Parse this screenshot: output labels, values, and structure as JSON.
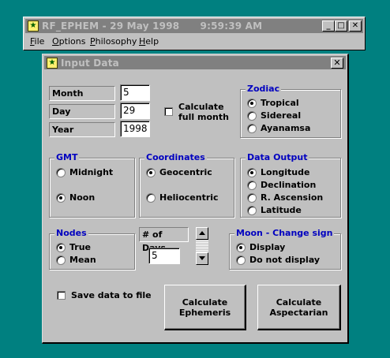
{
  "main_window": {
    "title": "RF_EPHEM - 29 May 1998      9:59:39 AM",
    "menu": [
      {
        "underline": "F",
        "rest": "ile"
      },
      {
        "underline": "O",
        "rest": "ptions"
      },
      {
        "underline": "P",
        "rest": "hilosophy"
      },
      {
        "underline": "H",
        "rest": "elp"
      }
    ],
    "caption_buttons": {
      "minimize": "_",
      "maximize": "□",
      "close": "✕"
    }
  },
  "dialog": {
    "title": "Input Data",
    "close": "✕",
    "date": {
      "month_label": "Month",
      "month_value": "5",
      "day_label": "Day",
      "day_value": "29",
      "year_label": "Year",
      "year_value": "1998"
    },
    "calc_full_month": {
      "label": "Calculate\nfull month",
      "checked": false
    },
    "zodiac": {
      "title": "Zodiac",
      "options": [
        "Tropical",
        "Sidereal",
        "Ayanamsa"
      ],
      "selected": 0
    },
    "gmt": {
      "title": "GMT",
      "options": [
        "Midnight",
        "Noon"
      ],
      "selected": 1
    },
    "coordinates": {
      "title": "Coordinates",
      "options": [
        "Geocentric",
        "Heliocentric"
      ],
      "selected": 0
    },
    "data_output": {
      "title": "Data Output",
      "options": [
        "Longitude",
        "Declination",
        "R. Ascension",
        "Latitude"
      ],
      "selected": 0
    },
    "nodes": {
      "title": "Nodes",
      "options": [
        "True",
        "Mean"
      ],
      "selected": 0
    },
    "days": {
      "label": "# of Days",
      "value": "5"
    },
    "moon": {
      "title": "Moon - Change sign",
      "options": [
        "Display",
        "Do not display"
      ],
      "selected": 0
    },
    "save_to_file": {
      "label": "Save data to file",
      "checked": false
    },
    "buttons": {
      "ephemeris": "Calculate\nEphemeris",
      "aspectarian": "Calculate\nAspectarian"
    }
  },
  "colors": {
    "desktop": "#008080",
    "group_title": "#0000c0",
    "inactive_titlebar": "#808080"
  }
}
